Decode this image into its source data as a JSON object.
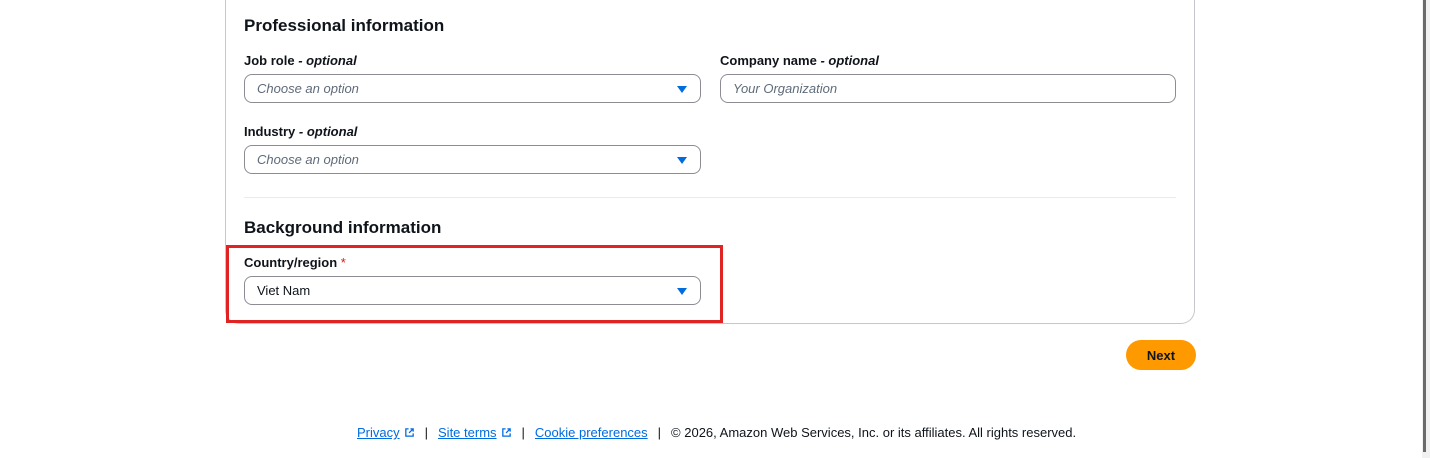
{
  "professional": {
    "heading": "Professional information",
    "job_role": {
      "label": "Job role",
      "optional": "- optional",
      "placeholder": "Choose an option"
    },
    "company_name": {
      "label": "Company name",
      "optional": "- optional",
      "placeholder": "Your Organization"
    },
    "industry": {
      "label": "Industry",
      "optional": "- optional",
      "placeholder": "Choose an option"
    }
  },
  "background": {
    "heading": "Background information",
    "country": {
      "label": "Country/region",
      "required_mark": "*",
      "value": "Viet Nam"
    }
  },
  "actions": {
    "next_label": "Next"
  },
  "footer": {
    "privacy": "Privacy",
    "site_terms": "Site terms",
    "cookie_preferences": "Cookie preferences",
    "separator": "|",
    "copyright": "© 2026, Amazon Web Services, Inc. or its affiliates. All rights reserved."
  },
  "colors": {
    "accent": "#006ce0",
    "primary_button": "#ff9900",
    "highlight": "#e02424",
    "required": "#d91515"
  },
  "icons": {
    "dropdown": "caret-down-icon",
    "external_link": "external-link-icon"
  }
}
